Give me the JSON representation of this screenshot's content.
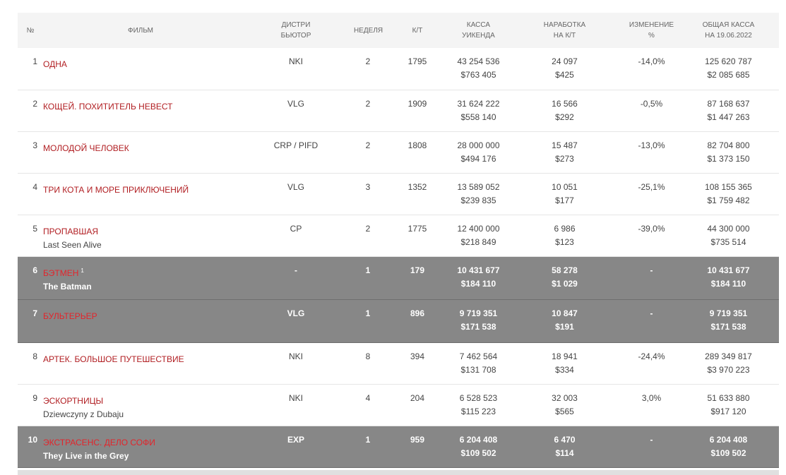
{
  "headers": {
    "rank": "№",
    "film": "Фильм",
    "distributor_1": "Дистри",
    "distributor_2": "бьютор",
    "week": "Неделя",
    "screens": "К/Т",
    "weekend_1": "Касса",
    "weekend_2": "уикенда",
    "avg_1": "Наработка",
    "avg_2": "на к/т",
    "change_1": "Изменение",
    "change_2": "%",
    "total_1": "Общая касса",
    "total_2": "на 19.06.2022"
  },
  "rows": [
    {
      "rank": "1",
      "title_ru": "Одна",
      "title_en": "",
      "sup": "",
      "distributor": "NKI",
      "week": "2",
      "screens": "1795",
      "weekend_rub": "43 254 536",
      "weekend_usd": "$763 405",
      "avg_rub": "24 097",
      "avg_usd": "$425",
      "change": "-14,0%",
      "total_rub": "125 620 787",
      "total_usd": "$2 085 685",
      "highlight": false
    },
    {
      "rank": "2",
      "title_ru": "Кощей. Похититель невест",
      "title_en": "",
      "sup": "",
      "distributor": "VLG",
      "week": "2",
      "screens": "1909",
      "weekend_rub": "31 624 222",
      "weekend_usd": "$558 140",
      "avg_rub": "16 566",
      "avg_usd": "$292",
      "change": "-0,5%",
      "total_rub": "87 168 637",
      "total_usd": "$1 447 263",
      "highlight": false
    },
    {
      "rank": "3",
      "title_ru": "Молодой человек",
      "title_en": "",
      "sup": "",
      "distributor": "CRP / PIFD",
      "week": "2",
      "screens": "1808",
      "weekend_rub": "28 000 000",
      "weekend_usd": "$494 176",
      "avg_rub": "15 487",
      "avg_usd": "$273",
      "change": "-13,0%",
      "total_rub": "82 704 800",
      "total_usd": "$1 373 150",
      "highlight": false
    },
    {
      "rank": "4",
      "title_ru": "Три кота и море приключений",
      "title_en": "",
      "sup": "",
      "distributor": "VLG",
      "week": "3",
      "screens": "1352",
      "weekend_rub": "13 589 052",
      "weekend_usd": "$239 835",
      "avg_rub": "10 051",
      "avg_usd": "$177",
      "change": "-25,1%",
      "total_rub": "108 155 365",
      "total_usd": "$1 759 482",
      "highlight": false
    },
    {
      "rank": "5",
      "title_ru": "Пропавшая",
      "title_en": "Last Seen Alive",
      "sup": "",
      "distributor": "CP",
      "week": "2",
      "screens": "1775",
      "weekend_rub": "12 400 000",
      "weekend_usd": "$218 849",
      "avg_rub": "6 986",
      "avg_usd": "$123",
      "change": "-39,0%",
      "total_rub": "44 300 000",
      "total_usd": "$735 514",
      "highlight": false
    },
    {
      "rank": "6",
      "title_ru": "Бэтмен",
      "title_en": "The Batman",
      "sup": "1",
      "distributor": "-",
      "week": "1",
      "screens": "179",
      "weekend_rub": "10 431 677",
      "weekend_usd": "$184 110",
      "avg_rub": "58 278",
      "avg_usd": "$1 029",
      "change": "-",
      "total_rub": "10 431 677",
      "total_usd": "$184 110",
      "highlight": true
    },
    {
      "rank": "7",
      "title_ru": "Бультерьер",
      "title_en": "",
      "sup": "",
      "distributor": "VLG",
      "week": "1",
      "screens": "896",
      "weekend_rub": "9 719 351",
      "weekend_usd": "$171 538",
      "avg_rub": "10 847",
      "avg_usd": "$191",
      "change": "-",
      "total_rub": "9 719 351",
      "total_usd": "$171 538",
      "highlight": true
    },
    {
      "rank": "8",
      "title_ru": "Артек. Большое путешествие",
      "title_en": "",
      "sup": "",
      "distributor": "NKI",
      "week": "8",
      "screens": "394",
      "weekend_rub": "7 462 564",
      "weekend_usd": "$131 708",
      "avg_rub": "18 941",
      "avg_usd": "$334",
      "change": "-24,4%",
      "total_rub": "289 349 817",
      "total_usd": "$3 970 223",
      "highlight": false
    },
    {
      "rank": "9",
      "title_ru": "Эскортницы",
      "title_en": "Dziewczyny z Dubaju",
      "sup": "",
      "distributor": "NKI",
      "week": "4",
      "screens": "204",
      "weekend_rub": "6 528 523",
      "weekend_usd": "$115 223",
      "avg_rub": "32 003",
      "avg_usd": "$565",
      "change": "3,0%",
      "total_rub": "51 633 880",
      "total_usd": "$917 120",
      "highlight": false
    },
    {
      "rank": "10",
      "title_ru": "Экстрасенс. Дело Софи",
      "title_en": "They Live in the Grey",
      "sup": "",
      "distributor": "EXP",
      "week": "1",
      "screens": "959",
      "weekend_rub": "6 204 408",
      "weekend_usd": "$109 502",
      "avg_rub": "6 470",
      "avg_usd": "$114",
      "change": "-",
      "total_rub": "6 204 408",
      "total_usd": "$109 502",
      "highlight": true
    }
  ],
  "colors": {
    "title_red": "#b11e22",
    "highlight_bg": "#878787",
    "header_bg": "#f4f4f4"
  }
}
